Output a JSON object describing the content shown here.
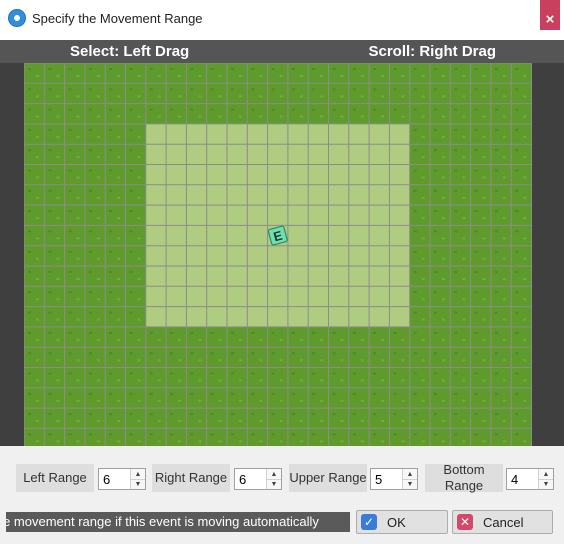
{
  "window": {
    "title": "Specify the Movement Range",
    "close_glyph": "×"
  },
  "hints": {
    "select": "Select: Left Drag",
    "scroll": "Scroll: Right Drag"
  },
  "map": {
    "event_label": "E",
    "grass_color": "#5f9a2c",
    "range_color": "#b9d28a",
    "grid_color": "#8c8c8c",
    "event_color": "#6fe0b0"
  },
  "ranges": [
    {
      "label": "Left Range",
      "value": "6"
    },
    {
      "label": "Right Range",
      "value": "6"
    },
    {
      "label": "Upper Range",
      "value": "5"
    },
    {
      "label": "Bottom Range",
      "value": "4"
    }
  ],
  "status": "Specify the movement range if this event is moving automatically",
  "buttons": {
    "ok": "OK",
    "cancel": "Cancel"
  },
  "icons": {
    "app": "gear-icon",
    "close": "close-icon",
    "ok": "check-icon",
    "cancel": "x-icon",
    "spin_up": "▲",
    "spin_down": "▼"
  }
}
